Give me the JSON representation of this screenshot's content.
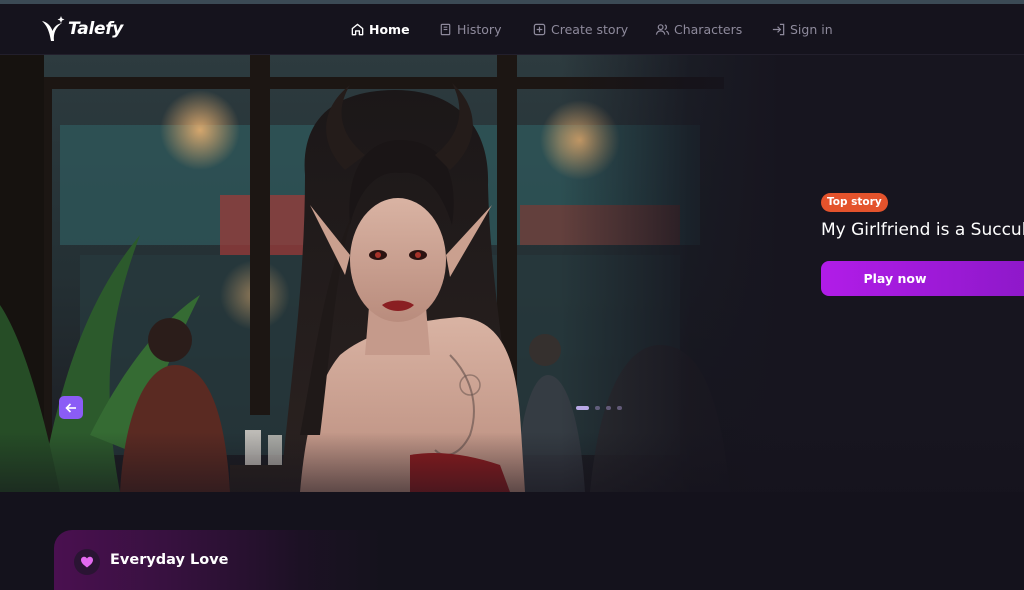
{
  "brand": {
    "name": "Talefy"
  },
  "nav": [
    {
      "label": "Home",
      "icon": "home-icon",
      "active": true
    },
    {
      "label": "History",
      "icon": "book-icon",
      "active": false
    },
    {
      "label": "Create story",
      "icon": "plus-square-icon",
      "active": false
    },
    {
      "label": "Characters",
      "icon": "users-icon",
      "active": false
    },
    {
      "label": "Sign in",
      "icon": "sign-in-icon",
      "active": false
    }
  ],
  "hero": {
    "badge": "Top story",
    "title": "My Girlfriend is a Succub",
    "cta": "Play now",
    "carousel": {
      "total": 4,
      "current": 1
    }
  },
  "section": {
    "title": "Everyday Love",
    "icon": "heart-icon"
  },
  "colors": {
    "accent": "#b11ce8",
    "badge": "#e4532c",
    "prev_button": "#8b5cf6",
    "background": "#14121c"
  }
}
